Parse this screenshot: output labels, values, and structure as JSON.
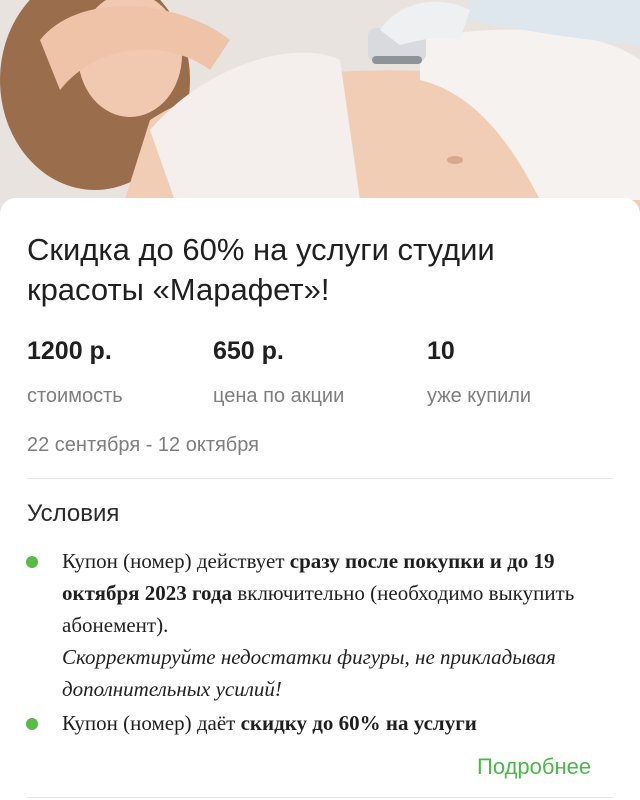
{
  "offer": {
    "title": "Скидка до 60% на услуги студии красоты «Марафет»!",
    "stats": [
      {
        "value": "1200 р.",
        "label": "стоимость"
      },
      {
        "value": "650 р.",
        "label": "цена по акции"
      },
      {
        "value": "10",
        "label": "уже купили"
      }
    ],
    "dates": "22 сентября - 12 октября"
  },
  "conditions": {
    "title": "Условия",
    "items": [
      {
        "text_1": "Купон (номер) действует ",
        "bold_1": "сразу после покупки и до 19 октября 2023 года",
        "text_2": " включительно (необходимо выкупить абонемент).",
        "italic": "Скорректируйте недостатки фигуры, не прикладывая дополнительных усилий!"
      },
      {
        "text_1": "Купон (номер) даёт ",
        "bold_1": "скидку до 60% на услуги"
      }
    ],
    "more_link": "Подробнее"
  },
  "colors": {
    "accent": "#5ab947",
    "link": "#4cb84a",
    "muted_text": "#7d7d7d"
  }
}
